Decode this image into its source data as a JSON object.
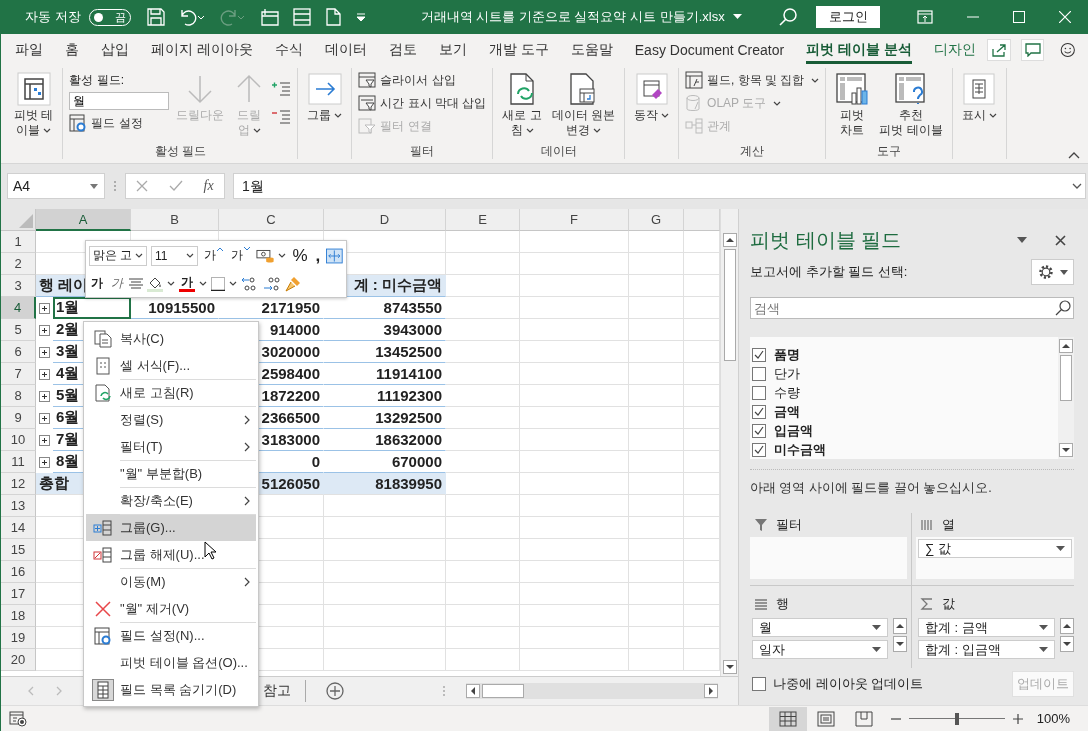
{
  "title_bar": {
    "autosave_label": "자동 저장",
    "autosave_toggle": {
      "label": "끔",
      "on": false
    },
    "file_name": "거래내역 시트를 기준으로 실적요약 시트 만들기.xlsx",
    "sign_in": "로그인"
  },
  "tabs": [
    {
      "label": "파일",
      "selected": false,
      "contextual": false
    },
    {
      "label": "홈",
      "selected": false,
      "contextual": false
    },
    {
      "label": "삽입",
      "selected": false,
      "contextual": false
    },
    {
      "label": "페이지 레이아웃",
      "selected": false,
      "contextual": false
    },
    {
      "label": "수식",
      "selected": false,
      "contextual": false
    },
    {
      "label": "데이터",
      "selected": false,
      "contextual": false
    },
    {
      "label": "검토",
      "selected": false,
      "contextual": false
    },
    {
      "label": "보기",
      "selected": false,
      "contextual": false
    },
    {
      "label": "개발 도구",
      "selected": false,
      "contextual": false
    },
    {
      "label": "도움말",
      "selected": false,
      "contextual": false
    },
    {
      "label": "Easy Document Creator",
      "selected": false,
      "contextual": false
    },
    {
      "label": "피벗 테이블 분석",
      "selected": true,
      "contextual": true
    },
    {
      "label": "디자인",
      "selected": false,
      "contextual": true
    }
  ],
  "ribbon": {
    "groups": [
      {
        "items": [
          {
            "kind": "large",
            "label": "피벗 테\n이블",
            "dropdown": true,
            "disabled": false
          }
        ]
      },
      {
        "label": "활성 필드",
        "items": [
          {
            "kind": "field",
            "label": "활성 필드:",
            "value": "월",
            "button": "필드 설정"
          },
          {
            "kind": "large",
            "label": "드릴다운",
            "dropdown": false,
            "disabled": true
          },
          {
            "kind": "large",
            "label": "드릴\n업",
            "dropdown": true,
            "disabled": true
          },
          {
            "kind": "toggles"
          }
        ]
      },
      {
        "items": [
          {
            "kind": "large",
            "label": "그룹",
            "dropdown": true,
            "disabled": false
          }
        ]
      },
      {
        "label": "필터",
        "items": [
          {
            "kind": "stack",
            "items": [
              {
                "label": "슬라이서 삽입",
                "dropdown": false,
                "disabled": false
              },
              {
                "label": "시간 표시 막대 삽입",
                "dropdown": false,
                "disabled": false
              },
              {
                "label": "필터 연결",
                "dropdown": false,
                "disabled": true
              }
            ]
          }
        ]
      },
      {
        "label": "데이터",
        "items": [
          {
            "kind": "large",
            "label": "새로 고\n침",
            "dropdown": true,
            "disabled": false
          },
          {
            "kind": "large",
            "label": "데이터 원본\n변경",
            "dropdown": true,
            "disabled": false
          }
        ]
      },
      {
        "items": [
          {
            "kind": "large",
            "label": "동작",
            "dropdown": true,
            "disabled": false
          }
        ]
      },
      {
        "label": "계산",
        "items": [
          {
            "kind": "stack",
            "items": [
              {
                "label": "필드, 항목 및 집합",
                "dropdown": true,
                "disabled": false
              },
              {
                "label": "OLAP 도구",
                "dropdown": true,
                "disabled": true
              },
              {
                "label": "관계",
                "dropdown": false,
                "disabled": true
              }
            ]
          }
        ]
      },
      {
        "label": "도구",
        "items": [
          {
            "kind": "large",
            "label": "피벗\n차트",
            "dropdown": false,
            "disabled": false
          },
          {
            "kind": "large",
            "label": "추천\n피벗 테이블",
            "dropdown": false,
            "disabled": false
          }
        ]
      },
      {
        "items": [
          {
            "kind": "large",
            "label": "표시",
            "dropdown": true,
            "disabled": false
          }
        ]
      }
    ]
  },
  "formula_bar": {
    "name_box": "A4",
    "fx": "fx",
    "value": "1월"
  },
  "sheet": {
    "columns": [
      {
        "label": "A",
        "selected": true
      },
      {
        "label": "B",
        "selected": false
      },
      {
        "label": "C",
        "selected": false
      },
      {
        "label": "D",
        "selected": false
      },
      {
        "label": "E",
        "selected": false
      },
      {
        "label": "F",
        "selected": false
      },
      {
        "label": "G",
        "selected": false
      }
    ],
    "rows": [
      {
        "number": "1",
        "kind": "empty",
        "selected": false
      },
      {
        "number": "2",
        "kind": "empty",
        "selected": false
      },
      {
        "number": "3",
        "kind": "header",
        "selected": false,
        "a": "행 레이",
        "d": "계 : 미수금액"
      },
      {
        "number": "4",
        "kind": "item",
        "selected": true,
        "a": "1월",
        "b": "10915500",
        "c": "2171950",
        "d": "8743550"
      },
      {
        "number": "5",
        "kind": "item",
        "selected": false,
        "a": "2월",
        "c": "914000",
        "d": "3943000"
      },
      {
        "number": "6",
        "kind": "item",
        "selected": false,
        "a": "3월",
        "c": "3020000",
        "d": "13452500"
      },
      {
        "number": "7",
        "kind": "item",
        "selected": false,
        "a": "4월",
        "c": "2598400",
        "d": "11914100"
      },
      {
        "number": "8",
        "kind": "item",
        "selected": false,
        "a": "5월",
        "c": "1872200",
        "d": "11192300"
      },
      {
        "number": "9",
        "kind": "item",
        "selected": false,
        "a": "6월",
        "c": "2366500",
        "d": "13292500"
      },
      {
        "number": "10",
        "kind": "item",
        "selected": false,
        "a": "7월",
        "c": "3183000",
        "d": "18632000"
      },
      {
        "number": "11",
        "kind": "item",
        "selected": false,
        "a": "8월",
        "c": "0",
        "d": "670000"
      },
      {
        "number": "12",
        "kind": "total",
        "selected": false,
        "a": "총합",
        "c": "5126050",
        "d": "81839950"
      },
      {
        "number": "13",
        "kind": "empty",
        "selected": false
      },
      {
        "number": "14",
        "kind": "empty",
        "selected": false
      },
      {
        "number": "15",
        "kind": "empty",
        "selected": false
      },
      {
        "number": "16",
        "kind": "empty",
        "selected": false
      },
      {
        "number": "17",
        "kind": "empty",
        "selected": false
      },
      {
        "number": "18",
        "kind": "empty",
        "selected": false
      },
      {
        "number": "19",
        "kind": "empty",
        "selected": false
      },
      {
        "number": "20",
        "kind": "empty",
        "selected": false
      }
    ],
    "sheet_tabs": [
      {
        "label": "참고",
        "selected": false
      }
    ]
  },
  "mini_toolbar": {
    "font": "맑은 고",
    "size": "11",
    "grow_font": "가",
    "shrink_font": "가",
    "percent": "%",
    "comma": ",",
    "bold": "가",
    "italic": "가",
    "font_color": "가"
  },
  "context_menu": {
    "items": [
      {
        "label": "복사(C)",
        "submenu": false,
        "selected": false,
        "separator_before": false
      },
      {
        "label": "셀 서식(F)...",
        "submenu": false,
        "selected": false,
        "separator_before": false
      },
      {
        "label": "새로 고침(R)",
        "submenu": false,
        "selected": false,
        "separator_before": true
      },
      {
        "label": "정렬(S)",
        "submenu": true,
        "selected": false,
        "separator_before": true
      },
      {
        "label": "필터(T)",
        "submenu": true,
        "selected": false,
        "separator_before": false
      },
      {
        "label": "\"월\" 부분합(B)",
        "submenu": false,
        "selected": false,
        "separator_before": true
      },
      {
        "label": "확장/축소(E)",
        "submenu": true,
        "selected": false,
        "separator_before": true
      },
      {
        "label": "그룹(G)...",
        "submenu": false,
        "selected": true,
        "separator_before": true
      },
      {
        "label": "그룹 해제(U)...",
        "submenu": false,
        "selected": false,
        "separator_before": false
      },
      {
        "label": "이동(M)",
        "submenu": true,
        "selected": false,
        "separator_before": true
      },
      {
        "label": "\"월\" 제거(V)",
        "submenu": false,
        "selected": false,
        "separator_before": false
      },
      {
        "label": "필드 설정(N)...",
        "submenu": false,
        "selected": false,
        "separator_before": true
      },
      {
        "label": "피벗 테이블 옵션(O)...",
        "submenu": false,
        "selected": false,
        "separator_before": false
      },
      {
        "label": "필드 목록 숨기기(D)",
        "submenu": false,
        "selected": false,
        "separator_before": false
      }
    ]
  },
  "pivot_pane": {
    "title": "피벗 테이블 필드",
    "subtitle": "보고서에 추가할 필드 선택:",
    "search_placeholder": "검색",
    "fields": [
      {
        "label": "품명",
        "checked": true
      },
      {
        "label": "단가",
        "checked": false
      },
      {
        "label": "수량",
        "checked": false
      },
      {
        "label": "금액",
        "checked": true
      },
      {
        "label": "입금액",
        "checked": true
      },
      {
        "label": "미수금액",
        "checked": true
      }
    ],
    "hint": "아래 영역 사이에 필드를 끌어 놓으십시오.",
    "areas": [
      {
        "kind": "filter",
        "label": "필터"
      },
      {
        "kind": "columns",
        "label": "열",
        "items": [
          "∑ 값"
        ]
      },
      {
        "kind": "rows",
        "label": "행",
        "items": [
          "월",
          "일자"
        ]
      },
      {
        "kind": "values",
        "label": "값",
        "items": [
          "합계 : 금액",
          "합계 : 입금액"
        ]
      }
    ],
    "defer": {
      "label": "나중에 레이아웃 업데이트",
      "checked": false
    },
    "update": {
      "label": "업데이트",
      "disabled": true
    }
  },
  "status_bar": {
    "views": [
      {
        "selected": true
      },
      {
        "selected": false
      },
      {
        "selected": false
      }
    ],
    "zoom": {
      "level": 0.5,
      "reading": "100%"
    }
  }
}
